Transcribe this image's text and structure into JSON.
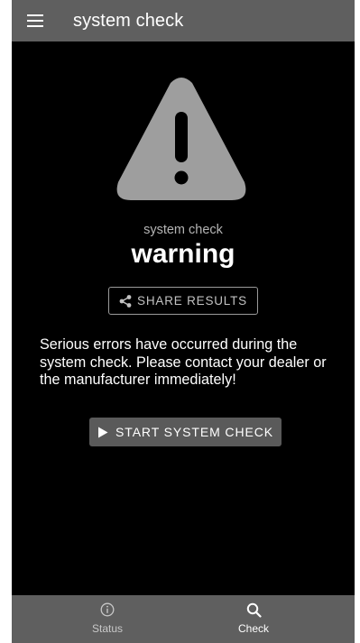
{
  "app_bar": {
    "title": "system check",
    "menu_icon": "hamburger-menu-icon"
  },
  "status": {
    "icon": "warning-triangle-icon",
    "subtitle": "system check",
    "state": "warning"
  },
  "share": {
    "label": "SHARE RESULTS",
    "icon": "share-icon"
  },
  "message": "Serious errors have occurred during the system check. Please contact your dealer or the manufacturer immediately!",
  "start_button": {
    "label": "START SYSTEM CHECK",
    "icon": "play-icon"
  },
  "bottom_nav": {
    "items": [
      {
        "label": "Status",
        "icon": "info-icon",
        "active": false
      },
      {
        "label": "Check",
        "icon": "search-icon",
        "active": true
      }
    ]
  },
  "colors": {
    "app_bar": "#5f5f5f",
    "background": "#000000",
    "icon_gray": "#9e9e9e",
    "button_gray": "#5a5a5a"
  }
}
